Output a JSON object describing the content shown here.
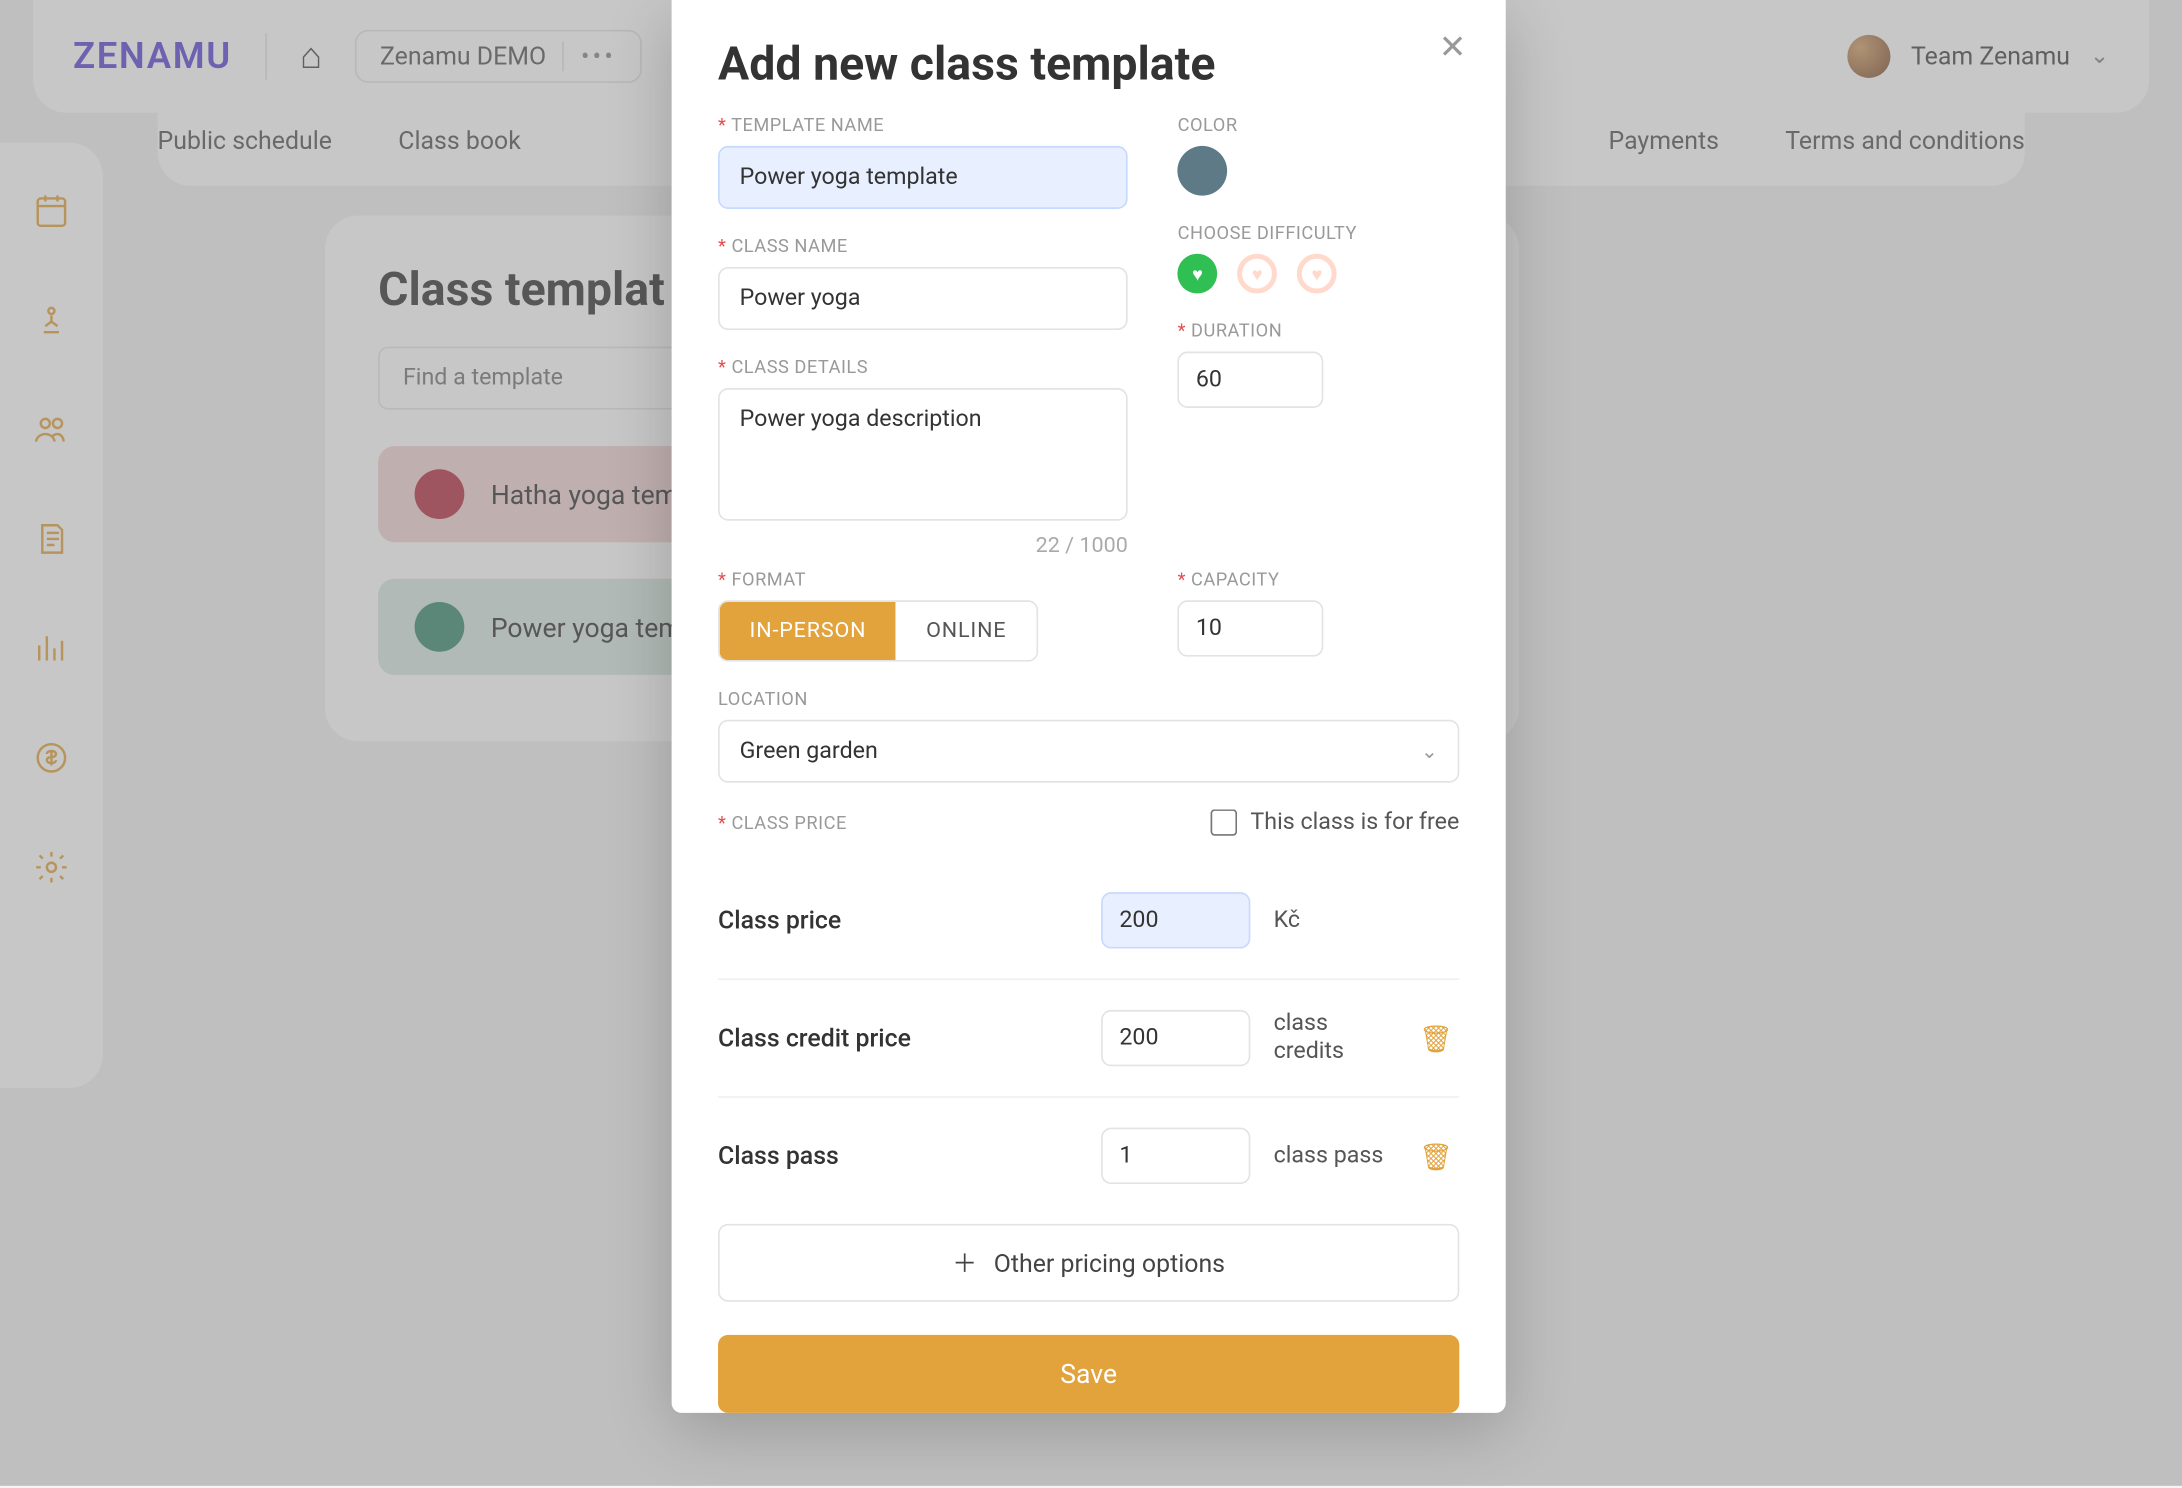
{
  "brand": "ZENAMU",
  "header": {
    "demo_label": "Zenamu DEMO",
    "user_label": "Team Zenamu"
  },
  "tabs": {
    "public_schedule": "Public schedule",
    "class_book": "Class book",
    "payments": "Payments",
    "terms": "Terms and conditions"
  },
  "page_title": "Class templat",
  "find_placeholder": "Find a template",
  "templates": {
    "t0": "Hatha yoga templa",
    "t1": "Power yoga templa"
  },
  "modal": {
    "title": "Add new class template",
    "labels": {
      "template_name": "Template name",
      "color": "Color",
      "class_name": "Class name",
      "choose_difficulty": "Choose difficulty",
      "class_details": "Class details",
      "duration": "Duration",
      "format": "Format",
      "capacity": "Capacity",
      "location": "Location",
      "class_price": "Class price",
      "free_checkbox": "This class is for free",
      "other_pricing": "Other pricing options",
      "save": "Save"
    },
    "format": {
      "in_person": "IN-PERSON",
      "online": "ONLINE"
    },
    "values": {
      "template_name": "Power yoga template",
      "class_name": "Power yoga",
      "class_details": "Power yoga description",
      "char_count": "22 / 1000",
      "duration": "60",
      "capacity": "10",
      "location": "Green garden"
    },
    "pricing": {
      "rows": {
        "r0": {
          "label": "Class price",
          "value": "200",
          "unit": "Kč"
        },
        "r1": {
          "label": "Class credit price",
          "value": "200",
          "unit": "class credits"
        },
        "r2": {
          "label": "Class pass",
          "value": "1",
          "unit": "class pass"
        }
      }
    }
  },
  "colors": {
    "accent": "#E2A23C",
    "template_color": "#5f7a87",
    "hatha": "#b73042",
    "power": "#3a8a70"
  }
}
